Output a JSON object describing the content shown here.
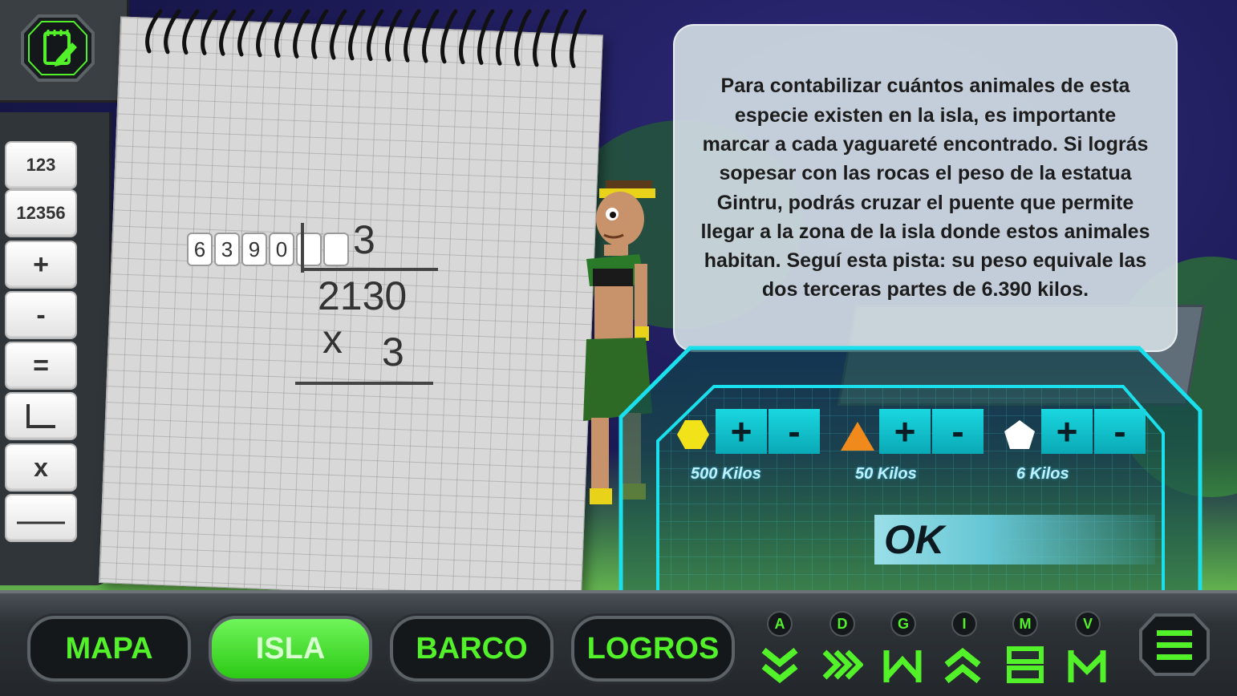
{
  "tools": {
    "items": [
      {
        "name": "tool-123",
        "label": "123"
      },
      {
        "name": "tool-12356",
        "label": "12356"
      },
      {
        "name": "tool-plus",
        "label": "+"
      },
      {
        "name": "tool-minus",
        "label": "-"
      },
      {
        "name": "tool-equals",
        "label": "="
      },
      {
        "name": "tool-division-bracket",
        "icon": "division-bracket-icon"
      },
      {
        "name": "tool-times",
        "label": "x"
      },
      {
        "name": "tool-line",
        "icon": "line-icon"
      }
    ],
    "notes_icon": "notepad-pencil-icon"
  },
  "notebook": {
    "dividend_digits": [
      "6",
      "3",
      "9",
      "0",
      "",
      ""
    ],
    "divisor": "3",
    "quotient": "2130",
    "times_sign": "x",
    "multiplier": "3"
  },
  "info_panel": {
    "text": "Para contabilizar cuántos animales de esta especie existen en la isla, es importante marcar a cada yaguareté encontrado. Si lográs sopesar con las rocas el peso de la estatua Gintru, podrás cruzar el puente que permite llegar a la zona de la isla donde estos animales habitan. Seguí esta pista: su peso equivale las dos terceras partes de 6.390 kilos."
  },
  "scale": {
    "weights": [
      {
        "shape": "hexagon",
        "color": "#f2e21a",
        "label": "500 Kilos",
        "plus": "+",
        "minus": "-"
      },
      {
        "shape": "triangle",
        "color": "#f08a1c",
        "label": "50 Kilos",
        "plus": "+",
        "minus": "-"
      },
      {
        "shape": "pentagon",
        "color": "#ffffff",
        "label": "6 Kilos",
        "plus": "+",
        "minus": "-"
      }
    ],
    "ok_label": "OK"
  },
  "nav": {
    "buttons": [
      {
        "name": "mapa-button",
        "label": "MAPA",
        "active": false
      },
      {
        "name": "isla-button",
        "label": "ISLA",
        "active": true
      },
      {
        "name": "barco-button",
        "label": "BARCO",
        "active": false
      },
      {
        "name": "logros-button",
        "label": "LOGROS",
        "active": false
      }
    ],
    "letters": [
      {
        "letter": "A",
        "icon": "double-chevron-down-icon"
      },
      {
        "letter": "D",
        "icon": "zigzag-arrows-icon"
      },
      {
        "letter": "G",
        "icon": "bracket-triangle-icon"
      },
      {
        "letter": "I",
        "icon": "double-chevron-up-icon"
      },
      {
        "letter": "M",
        "icon": "stacked-bars-icon"
      },
      {
        "letter": "V",
        "icon": "bracket-peak-icon"
      }
    ],
    "menu_icon": "hamburger-menu-icon"
  },
  "colors": {
    "accent_green": "#52f12a",
    "console_cyan": "#19e0ec",
    "panel_dark": "#2d3237"
  }
}
